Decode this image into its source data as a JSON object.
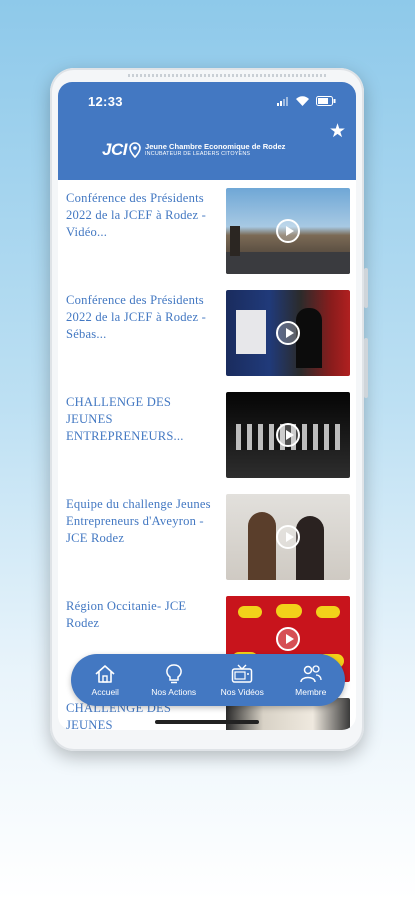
{
  "status_bar": {
    "time": "12:33"
  },
  "header": {
    "logo_mark": "JCI",
    "logo_title": "Jeune Chambre Economique de Rodez",
    "logo_subtitle": "INCUBATEUR DE LEADERS CITOYENS",
    "favorite_icon": "star-icon"
  },
  "videos": [
    {
      "title": "Conférence des Présidents 2022 de la JCEF à Rodez - Vidéo...",
      "thumb": "outdoor-road"
    },
    {
      "title": "Conférence des Présidents 2022 de la JCEF à Rodez - Sébas...",
      "thumb": "speaker-stage"
    },
    {
      "title": "CHALLENGE DES JEUNES ENTREPRENEURS...",
      "thumb": "group-stage"
    },
    {
      "title": "Equipe du challenge Jeunes Entrepreneurs d'Aveyron - JCE Rodez",
      "thumb": "two-women"
    },
    {
      "title": "Région Occitanie- JCE Rodez",
      "thumb": "red-slide"
    },
    {
      "title": "CHALLENGE DES JEUNES",
      "thumb": "people-bottom"
    }
  ],
  "nav": {
    "items": [
      {
        "label": "Accueil",
        "icon": "home-icon"
      },
      {
        "label": "Nos Actions",
        "icon": "lightbulb-icon"
      },
      {
        "label": "Nos Vidéos",
        "icon": "tv-icon"
      },
      {
        "label": "Membre",
        "icon": "members-icon"
      }
    ]
  },
  "colors": {
    "brand": "#4378c2",
    "background_top": "#8ec9ea"
  }
}
